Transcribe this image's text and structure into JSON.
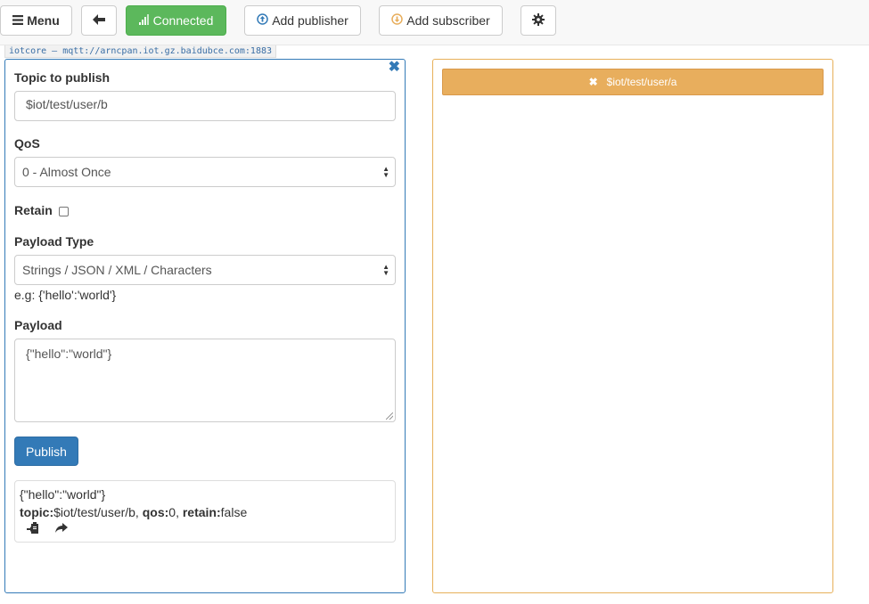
{
  "toolbar": {
    "menu_label": "Menu",
    "connected_label": "Connected",
    "add_publisher_label": "Add publisher",
    "add_subscriber_label": "Add subscriber"
  },
  "connection": {
    "label": "iotcore — mqtt://arncpan.iot.gz.baidubce.com:1883"
  },
  "publisher": {
    "topic_label": "Topic to publish",
    "topic_value": "$iot/test/user/b",
    "qos_label": "QoS",
    "qos_selected": "0 - Almost Once",
    "retain_label": "Retain",
    "retain_checked": false,
    "payload_type_label": "Payload Type",
    "payload_type_selected": "Strings / JSON / XML / Characters",
    "payload_hint": "e.g: {'hello':'world'}",
    "payload_label": "Payload",
    "payload_value": "{\"hello\":\"world\"}",
    "publish_label": "Publish",
    "history": [
      {
        "payload": "{\"hello\":\"world\"}",
        "topic_key": "topic:",
        "topic": "$iot/test/user/b,",
        "qos_key": "qos:",
        "qos": "0,",
        "retain_key": "retain:",
        "retain": "false"
      }
    ]
  },
  "subscriber": {
    "topic": "$iot/test/user/a"
  },
  "icons": {
    "menu": "hamburger-icon",
    "back": "arrow-left-icon",
    "connected": "signal-icon",
    "add_publisher": "arrow-up-circle-icon",
    "add_subscriber": "arrow-down-circle-icon",
    "settings": "gear-icon",
    "close": "close-icon",
    "copy": "copy-to-field-icon",
    "republish": "share-icon"
  },
  "colors": {
    "connected_green": "#5cb85c",
    "publisher_blue": "#337ab7",
    "subscriber_orange": "#e8ae5d"
  }
}
